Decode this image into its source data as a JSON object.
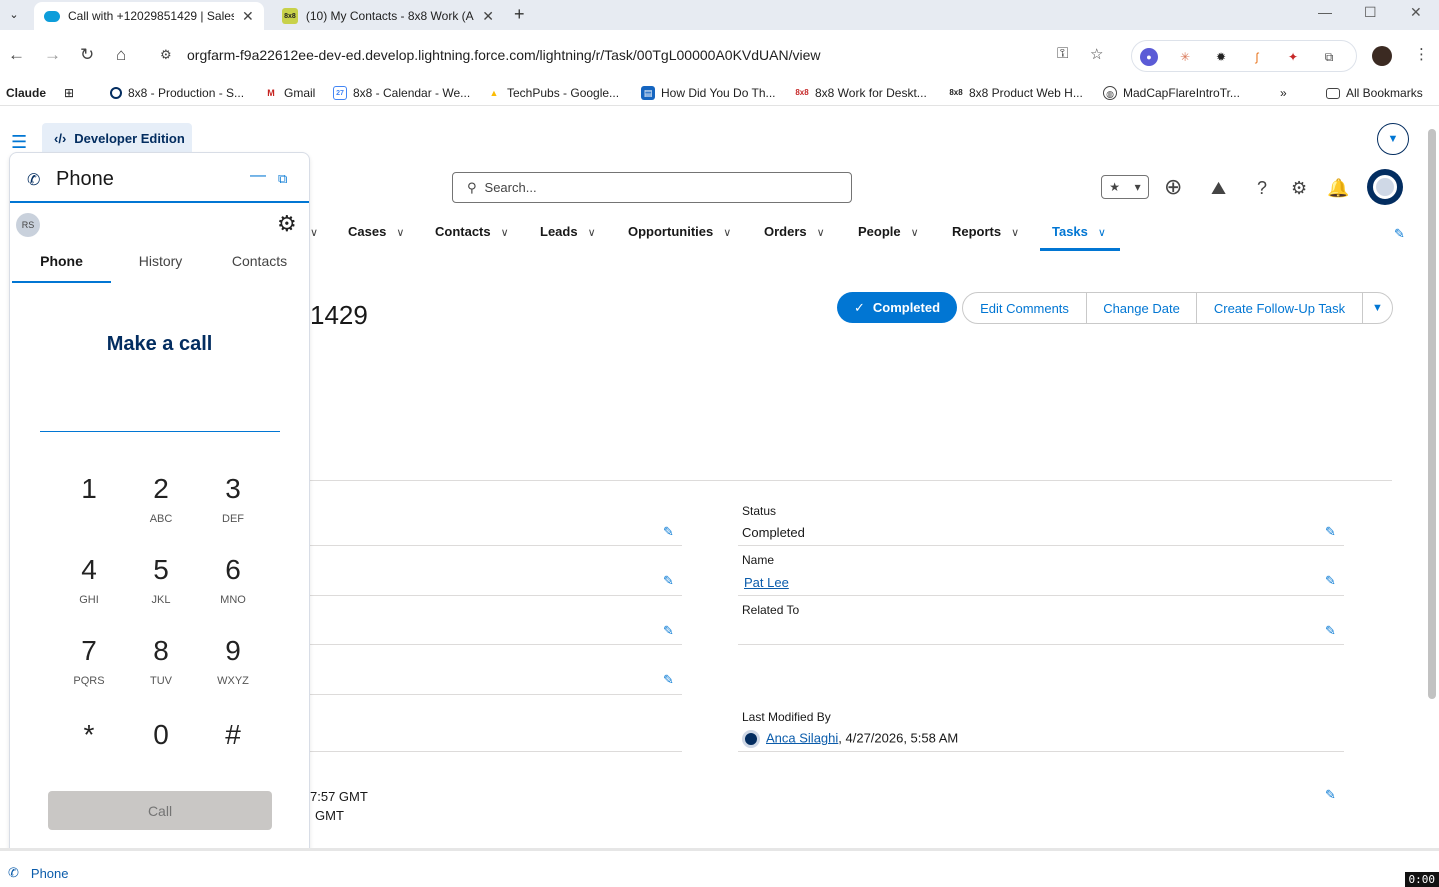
{
  "browser": {
    "tabs": [
      {
        "title": "Call with +12029851429 | Sales"
      },
      {
        "title": "(10) My Contacts - 8x8 Work (A"
      }
    ],
    "url": "orgfarm-f9a22612ee-dev-ed.develop.lightning.force.com/lightning/r/Task/00TgL00000A0KVdUAN/view",
    "bookmarks": [
      "Claude",
      "8x8 - Production - S...",
      "Gmail",
      "8x8 - Calendar - We...",
      "TechPubs - Google...",
      "How Did You Do Th...",
      "8x8 Work for Deskt...",
      "8x8 Product Web H...",
      "MadCapFlareIntroTr..."
    ],
    "all_bookmarks": "All Bookmarks"
  },
  "sf": {
    "app_badge": "Developer Edition",
    "search_placeholder": "Search...",
    "nav": [
      "Cases",
      "Contacts",
      "Leads",
      "Opportunities",
      "Orders",
      "People",
      "Reports",
      "Tasks"
    ],
    "record_title_fragment": "1429",
    "actions": {
      "completed": "Completed",
      "edit_comments": "Edit Comments",
      "change_date": "Change Date",
      "create_follow_up": "Create Follow-Up Task"
    },
    "fields": {
      "status_label": "Status",
      "status_value": "Completed",
      "name_label": "Name",
      "name_value": "Pat Lee",
      "related_label": "Related To",
      "last_modified_label": "Last Modified By",
      "last_modified_user": "Anca Silaghi",
      "last_modified_date": ", 4/27/2026, 5:58 AM",
      "time_line1": "7:57 GMT",
      "time_line2": "GMT"
    },
    "bottom_bar": "Phone",
    "timer": "0:00"
  },
  "phone": {
    "title": "Phone",
    "avatar": "RS",
    "tabs": [
      "Phone",
      "History",
      "Contacts"
    ],
    "heading": "Make a call",
    "keys": [
      {
        "d": "1",
        "l": ""
      },
      {
        "d": "2",
        "l": "ABC"
      },
      {
        "d": "3",
        "l": "DEF"
      },
      {
        "d": "4",
        "l": "GHI"
      },
      {
        "d": "5",
        "l": "JKL"
      },
      {
        "d": "6",
        "l": "MNO"
      },
      {
        "d": "7",
        "l": "PQRS"
      },
      {
        "d": "8",
        "l": "TUV"
      },
      {
        "d": "9",
        "l": "WXYZ"
      },
      {
        "d": "*",
        "l": ""
      },
      {
        "d": "0",
        "l": ""
      },
      {
        "d": "#",
        "l": ""
      }
    ],
    "call_button": "Call"
  },
  "colors": {
    "brand": "#0176d3",
    "navy": "#032d60"
  }
}
